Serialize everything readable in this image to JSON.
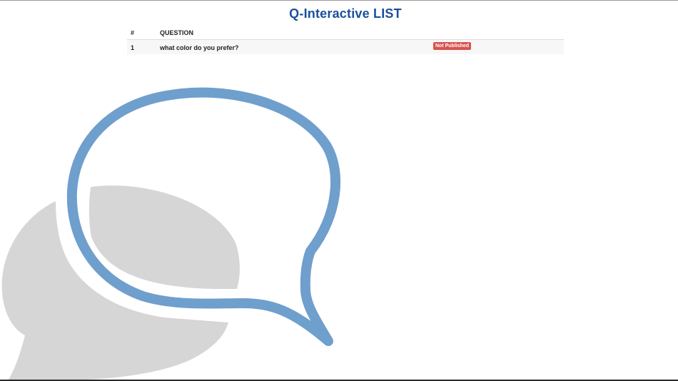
{
  "header": {
    "title": "Q-Interactive LIST"
  },
  "table": {
    "columns": {
      "num": "#",
      "question": "QUESTION"
    },
    "rows": [
      {
        "num": "1",
        "question": "what color do you prefer?",
        "status": "Not Published",
        "status_color": "#d9534f"
      }
    ]
  },
  "background_logo": {
    "icon": "speech-bubbles-icon",
    "outline_color": "#6f9fcc",
    "fill_color": "#d6d6d6"
  },
  "colors": {
    "title": "#1a4f9c",
    "row_background": "#f7f7f7"
  }
}
